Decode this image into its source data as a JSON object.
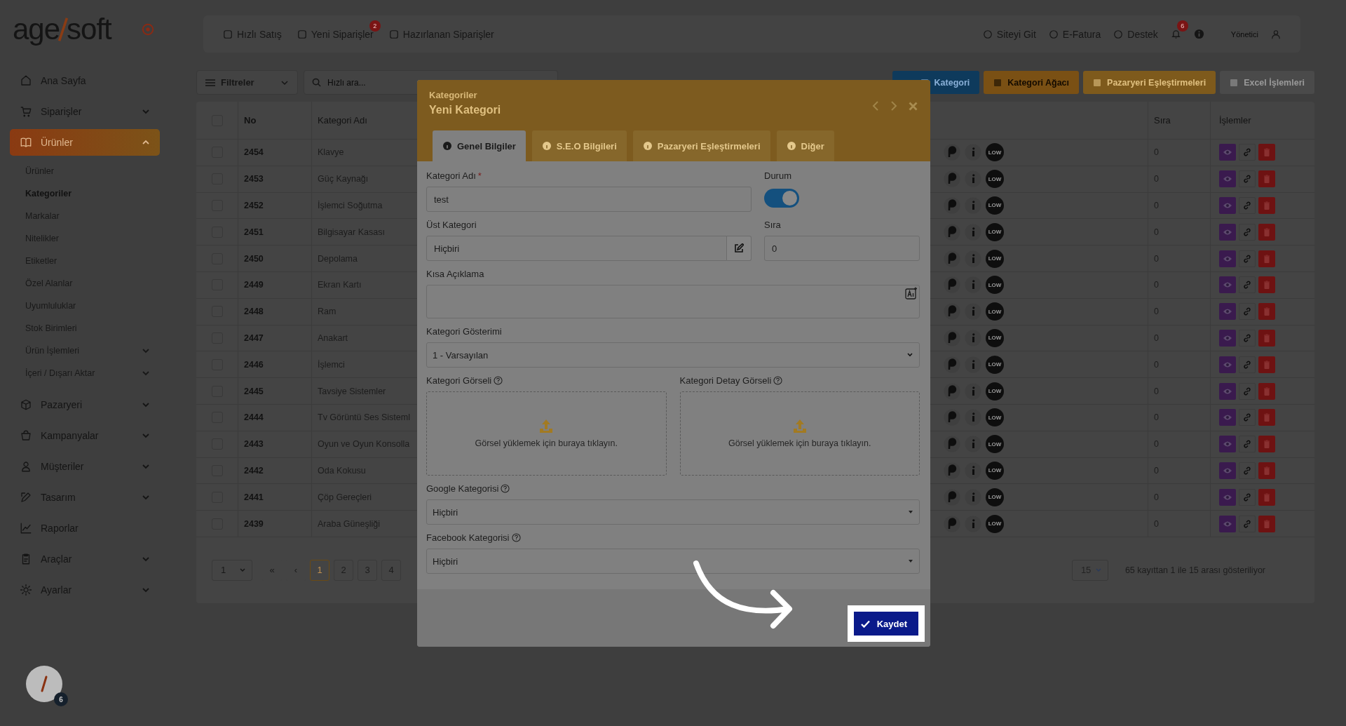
{
  "logo": {
    "left": "age",
    "right": "soft"
  },
  "sidebar": {
    "items": [
      {
        "label": "Ana Sayfa",
        "expandable": false,
        "selected": false
      },
      {
        "label": "Siparişler",
        "expandable": true,
        "expanded": false,
        "selected": false
      },
      {
        "label": "Ürünler",
        "expandable": true,
        "expanded": true,
        "selected": true,
        "children": [
          {
            "label": "Ürünler",
            "expandable": false,
            "selected": false
          },
          {
            "label": "Kategoriler",
            "expandable": false,
            "selected": true
          },
          {
            "label": "Markalar",
            "expandable": false,
            "selected": false
          },
          {
            "label": "Nitelikler",
            "expandable": false,
            "selected": false
          },
          {
            "label": "Etiketler",
            "expandable": false,
            "selected": false
          },
          {
            "label": "Özel Alanlar",
            "expandable": false,
            "selected": false
          },
          {
            "label": "Uyumluluklar",
            "expandable": false,
            "selected": false
          },
          {
            "label": "Stok Birimleri",
            "expandable": false,
            "selected": false
          },
          {
            "label": "Ürün İşlemleri",
            "expandable": true,
            "selected": false
          },
          {
            "label": "İçeri / Dışarı Aktar",
            "expandable": true,
            "selected": false
          }
        ]
      },
      {
        "label": "Pazaryeri",
        "expandable": true,
        "expanded": false,
        "selected": false
      },
      {
        "label": "Kampanyalar",
        "expandable": true,
        "expanded": false,
        "selected": false
      },
      {
        "label": "Müşteriler",
        "expandable": true,
        "expanded": false,
        "selected": false
      },
      {
        "label": "Tasarım",
        "expandable": true,
        "expanded": false,
        "selected": false
      },
      {
        "label": "Raporlar",
        "expandable": false,
        "selected": false
      },
      {
        "label": "Araçlar",
        "expandable": true,
        "expanded": false,
        "selected": false
      },
      {
        "label": "Ayarlar",
        "expandable": true,
        "expanded": false,
        "selected": false
      }
    ],
    "assistant_badge": "6"
  },
  "top_bar": {
    "left_links": [
      {
        "label": "Hızlı Satış"
      },
      {
        "label": "Yeni Siparişler",
        "badge": "2"
      },
      {
        "label": "Hazırlanan Siparişler"
      }
    ],
    "right_links": [
      {
        "label": "Siteyi Git"
      },
      {
        "label": "E-Fatura"
      },
      {
        "label": "Destek"
      }
    ],
    "notification_badge": "6",
    "user": "Yönetici"
  },
  "toolbar": {
    "filter": "Filtreler",
    "search": {
      "placeholder": "Hızlı ara..."
    },
    "buttons": [
      {
        "label": "Kategori",
        "kind": "add"
      },
      {
        "label": "Kategori Ağacı",
        "kind": "tree"
      },
      {
        "label": "Pazaryeri Eşleştirmeleri",
        "kind": "match"
      },
      {
        "label": "Excel İşlemleri",
        "kind": "excel"
      }
    ]
  },
  "table": {
    "select_all_checked": false,
    "columns": [
      "No",
      "Kategori Adı",
      "Sıra",
      "İşlemler"
    ],
    "rows": [
      {
        "no": "2454",
        "name": "Klavye",
        "badge": "LOW",
        "order": "0",
        "checked": false
      },
      {
        "no": "2453",
        "name": "Güç Kaynağı",
        "badge": "LOW",
        "order": "0",
        "checked": false
      },
      {
        "no": "2452",
        "name": "İşlemci Soğutma",
        "badge": "LOW",
        "order": "0",
        "checked": false
      },
      {
        "no": "2451",
        "name": "Bilgisayar Kasası",
        "badge": "LOW",
        "order": "0",
        "checked": false
      },
      {
        "no": "2450",
        "name": "Depolama",
        "badge": "LOW",
        "order": "0",
        "checked": false
      },
      {
        "no": "2449",
        "name": "Ekran Kartı",
        "badge": "LOW",
        "order": "0",
        "checked": false
      },
      {
        "no": "2448",
        "name": "Ram",
        "badge": "LOW",
        "order": "0",
        "checked": false
      },
      {
        "no": "2447",
        "name": "Anakart",
        "badge": "LOW",
        "order": "0",
        "checked": false
      },
      {
        "no": "2446",
        "name": "İşlemci",
        "badge": "LOW",
        "order": "0",
        "checked": false
      },
      {
        "no": "2445",
        "name": "Tavsiye Sistemler",
        "badge": "LOW",
        "order": "0",
        "checked": false
      },
      {
        "no": "2444",
        "name": "Tv Görüntü Ses Sisteml",
        "badge": "LOW",
        "order": "0",
        "checked": false
      },
      {
        "no": "2443",
        "name": "Oyun ve Oyun Konsolla",
        "badge": "LOW",
        "order": "0",
        "checked": false
      },
      {
        "no": "2442",
        "name": "Oda Kokusu",
        "badge": "LOW",
        "order": "0",
        "checked": false
      },
      {
        "no": "2441",
        "name": "Çöp Gereçleri",
        "badge": "LOW",
        "order": "0",
        "checked": false
      },
      {
        "no": "2439",
        "name": "Araba Güneşliği",
        "badge": "LOW",
        "order": "0",
        "checked": false
      }
    ]
  },
  "pagination": {
    "jump": "1",
    "first": "«",
    "prev": "‹",
    "pages": [
      {
        "label": "1",
        "selected": true
      },
      {
        "label": "2",
        "selected": false
      },
      {
        "label": "3",
        "selected": false
      },
      {
        "label": "4",
        "selected": false
      }
    ],
    "per_page": "15",
    "summary": "65 kayıttan 1 ile 15 arası gösteriliyor"
  },
  "modal": {
    "section": "Kategoriler",
    "title": "Yeni Kategori",
    "tabs": [
      {
        "label": "Genel Bilgiler",
        "selected": true
      },
      {
        "label": "S.E.O Bilgileri",
        "selected": false
      },
      {
        "label": "Pazaryeri Eşleştirmeleri",
        "selected": false
      },
      {
        "label": "Diğer",
        "selected": false
      }
    ],
    "name": {
      "label": "Kategori Adı",
      "required_mark": "*",
      "value": "test"
    },
    "status": {
      "label": "Durum",
      "on": true
    },
    "parent": {
      "label": "Üst Kategori",
      "value": "Hiçbiri"
    },
    "order": {
      "label": "Sıra",
      "value": "0"
    },
    "short_description": {
      "label": "Kısa Açıklama"
    },
    "display": {
      "label": "Kategori Gösterimi",
      "value": "1 - Varsayılan"
    },
    "images": [
      {
        "label": "Kategori Görseli",
        "hint": "Görsel yüklemek için buraya tıklayın."
      },
      {
        "label": "Kategori Detay Görseli",
        "hint": "Görsel yüklemek için buraya tıklayın."
      }
    ],
    "google": {
      "label": "Google Kategorisi",
      "value": "Hiçbiri"
    },
    "facebook": {
      "label": "Facebook Kategorisi",
      "value": "Hiçbiri"
    },
    "save": "Kaydet"
  }
}
